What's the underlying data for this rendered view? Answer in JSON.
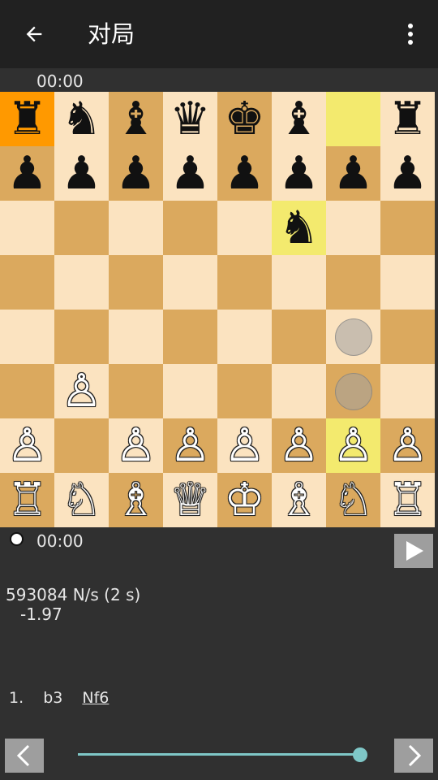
{
  "app_bar": {
    "title": "对局",
    "back_icon": "arrow-back-icon",
    "menu_icon": "more-vert-icon"
  },
  "clocks": {
    "top": "00:00",
    "bottom": "00:00"
  },
  "board": {
    "squares": [
      {
        "id": "a8",
        "shade": "sel",
        "piece": "♜",
        "color": "black"
      },
      {
        "id": "b8",
        "shade": "light",
        "piece": "♞",
        "color": "black"
      },
      {
        "id": "c8",
        "shade": "dark",
        "piece": "♝",
        "color": "black"
      },
      {
        "id": "d8",
        "shade": "light",
        "piece": "♛",
        "color": "black"
      },
      {
        "id": "e8",
        "shade": "dark",
        "piece": "♚",
        "color": "black"
      },
      {
        "id": "f8",
        "shade": "light",
        "piece": "♝",
        "color": "black"
      },
      {
        "id": "g8",
        "shade": "hl",
        "piece": "",
        "color": ""
      },
      {
        "id": "h8",
        "shade": "light",
        "piece": "♜",
        "color": "black"
      },
      {
        "id": "a7",
        "shade": "dark",
        "piece": "♟",
        "color": "black"
      },
      {
        "id": "b7",
        "shade": "light",
        "piece": "♟",
        "color": "black"
      },
      {
        "id": "c7",
        "shade": "dark",
        "piece": "♟",
        "color": "black"
      },
      {
        "id": "d7",
        "shade": "light",
        "piece": "♟",
        "color": "black"
      },
      {
        "id": "e7",
        "shade": "dark",
        "piece": "♟",
        "color": "black"
      },
      {
        "id": "f7",
        "shade": "light",
        "piece": "♟",
        "color": "black"
      },
      {
        "id": "g7",
        "shade": "dark",
        "piece": "♟",
        "color": "black"
      },
      {
        "id": "h7",
        "shade": "light",
        "piece": "♟",
        "color": "black"
      },
      {
        "id": "a6",
        "shade": "light",
        "piece": "",
        "color": ""
      },
      {
        "id": "b6",
        "shade": "dark",
        "piece": "",
        "color": ""
      },
      {
        "id": "c6",
        "shade": "light",
        "piece": "",
        "color": ""
      },
      {
        "id": "d6",
        "shade": "dark",
        "piece": "",
        "color": ""
      },
      {
        "id": "e6",
        "shade": "light",
        "piece": "",
        "color": ""
      },
      {
        "id": "f6",
        "shade": "hl",
        "piece": "♞",
        "color": "black"
      },
      {
        "id": "g6",
        "shade": "light",
        "piece": "",
        "color": ""
      },
      {
        "id": "h6",
        "shade": "dark",
        "piece": "",
        "color": ""
      },
      {
        "id": "a5",
        "shade": "dark",
        "piece": "",
        "color": ""
      },
      {
        "id": "b5",
        "shade": "light",
        "piece": "",
        "color": ""
      },
      {
        "id": "c5",
        "shade": "dark",
        "piece": "",
        "color": ""
      },
      {
        "id": "d5",
        "shade": "light",
        "piece": "",
        "color": ""
      },
      {
        "id": "e5",
        "shade": "dark",
        "piece": "",
        "color": ""
      },
      {
        "id": "f5",
        "shade": "light",
        "piece": "",
        "color": ""
      },
      {
        "id": "g5",
        "shade": "dark",
        "piece": "",
        "color": ""
      },
      {
        "id": "h5",
        "shade": "light",
        "piece": "",
        "color": ""
      },
      {
        "id": "a4",
        "shade": "light",
        "piece": "",
        "color": ""
      },
      {
        "id": "b4",
        "shade": "dark",
        "piece": "",
        "color": ""
      },
      {
        "id": "c4",
        "shade": "light",
        "piece": "",
        "color": ""
      },
      {
        "id": "d4",
        "shade": "dark",
        "piece": "",
        "color": ""
      },
      {
        "id": "e4",
        "shade": "light",
        "piece": "",
        "color": ""
      },
      {
        "id": "f4",
        "shade": "dark",
        "piece": "",
        "color": ""
      },
      {
        "id": "g4",
        "shade": "light",
        "piece": "",
        "color": "",
        "hint": true
      },
      {
        "id": "h4",
        "shade": "dark",
        "piece": "",
        "color": ""
      },
      {
        "id": "a3",
        "shade": "dark",
        "piece": "",
        "color": ""
      },
      {
        "id": "b3",
        "shade": "light",
        "piece": "♙",
        "color": "white"
      },
      {
        "id": "c3",
        "shade": "dark",
        "piece": "",
        "color": ""
      },
      {
        "id": "d3",
        "shade": "light",
        "piece": "",
        "color": ""
      },
      {
        "id": "e3",
        "shade": "dark",
        "piece": "",
        "color": ""
      },
      {
        "id": "f3",
        "shade": "light",
        "piece": "",
        "color": ""
      },
      {
        "id": "g3",
        "shade": "dark",
        "piece": "",
        "color": "",
        "hint": true
      },
      {
        "id": "h3",
        "shade": "light",
        "piece": "",
        "color": ""
      },
      {
        "id": "a2",
        "shade": "light",
        "piece": "♙",
        "color": "white"
      },
      {
        "id": "b2",
        "shade": "dark",
        "piece": "",
        "color": ""
      },
      {
        "id": "c2",
        "shade": "light",
        "piece": "♙",
        "color": "white"
      },
      {
        "id": "d2",
        "shade": "dark",
        "piece": "♙",
        "color": "white"
      },
      {
        "id": "e2",
        "shade": "light",
        "piece": "♙",
        "color": "white"
      },
      {
        "id": "f2",
        "shade": "dark",
        "piece": "♙",
        "color": "white"
      },
      {
        "id": "g2",
        "shade": "hl",
        "piece": "♙",
        "color": "white"
      },
      {
        "id": "h2",
        "shade": "dark",
        "piece": "♙",
        "color": "white"
      },
      {
        "id": "a1",
        "shade": "dark",
        "piece": "♖",
        "color": "white"
      },
      {
        "id": "b1",
        "shade": "light",
        "piece": "♘",
        "color": "white"
      },
      {
        "id": "c1",
        "shade": "dark",
        "piece": "♗",
        "color": "white"
      },
      {
        "id": "d1",
        "shade": "light",
        "piece": "♕",
        "color": "white"
      },
      {
        "id": "e1",
        "shade": "dark",
        "piece": "♔",
        "color": "white"
      },
      {
        "id": "f1",
        "shade": "light",
        "piece": "♗",
        "color": "white"
      },
      {
        "id": "g1",
        "shade": "dark",
        "piece": "♘",
        "color": "white"
      },
      {
        "id": "h1",
        "shade": "light",
        "piece": "♖",
        "color": "white"
      }
    ]
  },
  "engine": {
    "speed": "593084 N/s (2 s)",
    "score": "-1.97"
  },
  "moves": {
    "number": "1.",
    "white": "b3",
    "black": "Nf6"
  },
  "controls": {
    "play_icon": "play-icon",
    "prev_icon": "chevron-left-icon",
    "next_icon": "chevron-right-icon",
    "slider_position": 1.0
  },
  "colors": {
    "light_square": "#fbe3c0",
    "dark_square": "#dba95e",
    "highlight": "#f3ea6e",
    "selected": "#ff9900",
    "accent": "#7fc7c7"
  }
}
